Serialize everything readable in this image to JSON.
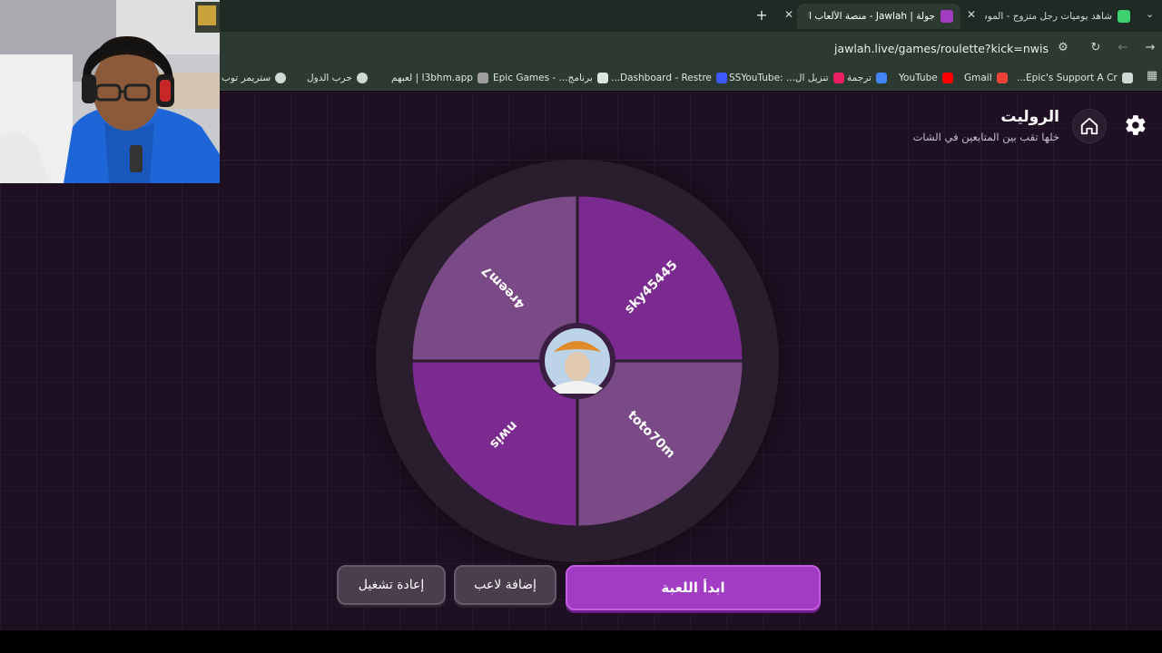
{
  "browser": {
    "tabs": [
      {
        "title": "شاهد يوميات رجل متزوج - الموس",
        "fav_color": "#3ecf6e"
      },
      {
        "title": "جولة | Jawlah - منصة الألعاب التف",
        "fav_color": "#a23cc3",
        "active": true
      }
    ],
    "url": "jawlah.live/games/roulette?kick=nwis",
    "bookmarks": [
      {
        "label": "Epic's Support A Cr...",
        "color": "#cfd8d2"
      },
      {
        "label": "Gmail",
        "color": "#ea4335"
      },
      {
        "label": "YouTube",
        "color": "#ff0000"
      },
      {
        "label": "ترجمة",
        "color": "#4285f4"
      },
      {
        "label": "تنزيل ال... :SSYouTube",
        "color": "#e91e63"
      },
      {
        "label": "Dashboard - Restre...",
        "color": "#3d5afe"
      },
      {
        "label": "برنامج... - Epic Games",
        "color": "#dfe6e1"
      },
      {
        "label": "I3bhm.app | لعبهم",
        "color": "#9e9e9e"
      },
      {
        "label": "حرب الدول",
        "color": "#cfd8d2"
      },
      {
        "label": "ستريمر توب",
        "color": "#cfd8d2"
      }
    ]
  },
  "game": {
    "title": "الروليت",
    "subtitle": "خلها تقب بين المتابعين في الشات",
    "wheel": {
      "segments": [
        {
          "name": "sky45445",
          "color": "#7b2a90"
        },
        {
          "name": "toto70m",
          "color": "#7a4a86"
        },
        {
          "name": "nwis",
          "color": "#7b2a90"
        },
        {
          "name": "4reem7",
          "color": "#7a4a86"
        }
      ]
    },
    "buttons": {
      "start": "ابدأ اللعبة",
      "add_player": "إضافة لاعب",
      "replay": "إعادة تشغيل"
    }
  },
  "colors": {
    "accent": "#a23cc3",
    "background": "#1e0f22"
  }
}
